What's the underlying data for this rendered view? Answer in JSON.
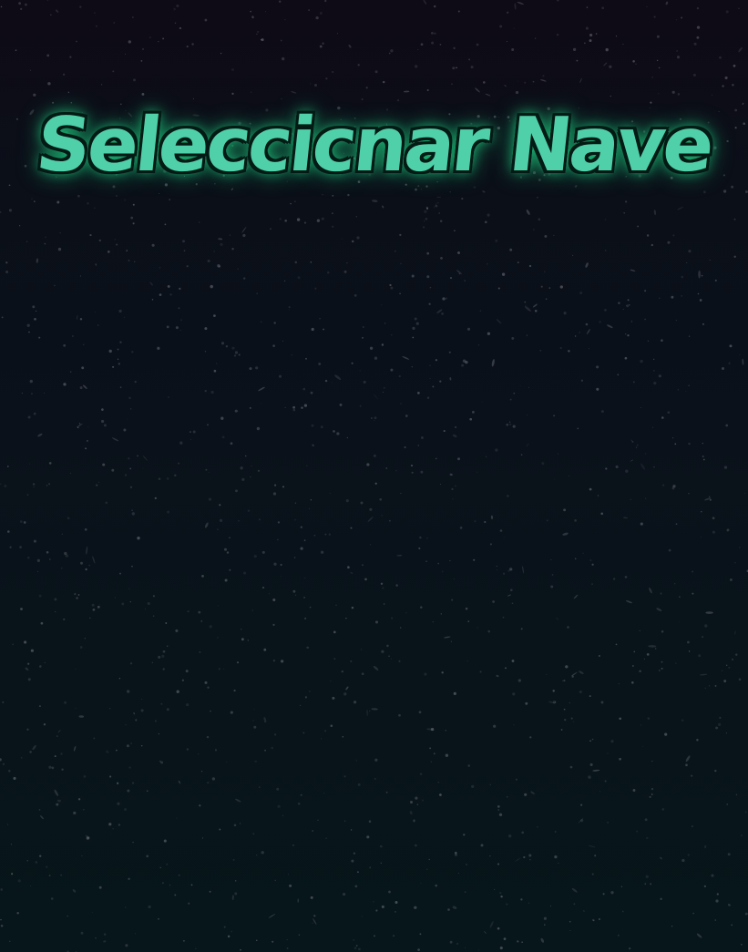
{
  "screen": {
    "title": "Seleccicnar Nave"
  },
  "colors": {
    "title_fill": "#4fd0a8",
    "title_outline": "#041a14",
    "title_glow": "#1fd184",
    "background_top": "#0e0a16",
    "background_bottom": "#07161a",
    "speckle": "#8a8a94"
  }
}
